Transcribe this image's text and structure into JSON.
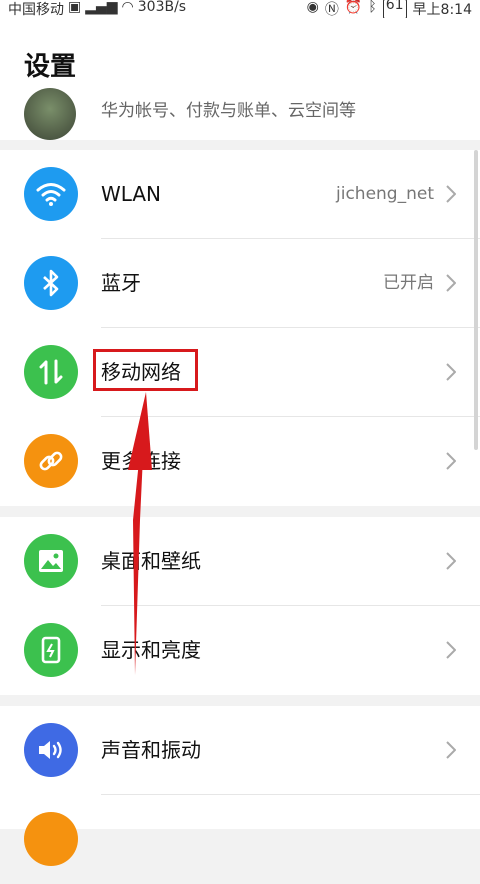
{
  "status_bar": {
    "carrier": "中国移动",
    "network_speed": "303B/s",
    "battery": "61",
    "time": "早上8:14"
  },
  "header": {
    "title": "设置",
    "account_subtitle": "华为帐号、付款与账单、云空间等"
  },
  "groups": [
    {
      "items": [
        {
          "label": "WLAN",
          "value": "jicheng_net",
          "icon": "wifi-icon",
          "color": "#1e9bf0"
        },
        {
          "label": "蓝牙",
          "value": "已开启",
          "icon": "bluetooth-icon",
          "color": "#1e9bf0"
        },
        {
          "label": "移动网络",
          "value": "",
          "icon": "mobile-data-icon",
          "color": "#3cc14e"
        },
        {
          "label": "更多连接",
          "value": "",
          "icon": "link-icon",
          "color": "#f5920f"
        }
      ]
    },
    {
      "items": [
        {
          "label": "桌面和壁纸",
          "value": "",
          "icon": "wallpaper-icon",
          "color": "#3cc14e"
        },
        {
          "label": "显示和亮度",
          "value": "",
          "icon": "display-icon",
          "color": "#3cc14e"
        }
      ]
    },
    {
      "items": [
        {
          "label": "声音和振动",
          "value": "",
          "icon": "sound-icon",
          "color": "#3f6ae4"
        }
      ]
    }
  ],
  "annotation_color": "#d7191c"
}
